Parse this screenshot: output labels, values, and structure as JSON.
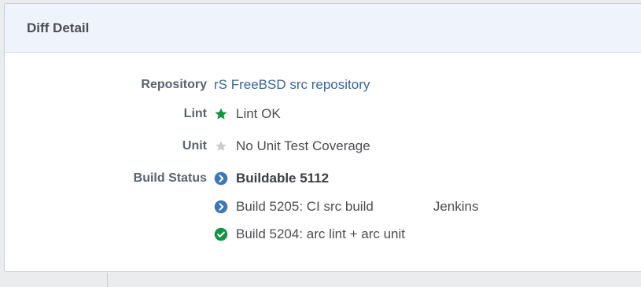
{
  "panel": {
    "title": "Diff Detail"
  },
  "details": {
    "repository": {
      "label": "Repository",
      "value": "rS FreeBSD src repository"
    },
    "lint": {
      "label": "Lint",
      "icon": "star-icon",
      "icon_color": "#139543",
      "value": "Lint OK"
    },
    "unit": {
      "label": "Unit",
      "icon": "star-icon",
      "icon_color": "#c8cbd0",
      "value": "No Unit Test Coverage"
    },
    "build_status": {
      "label": "Build Status",
      "buildable": {
        "icon": "chevron-circle-right-icon",
        "icon_color": "#3c77b8",
        "text": "Buildable 5112"
      },
      "builds": [
        {
          "icon": "chevron-circle-right-icon",
          "icon_color": "#3c77b8",
          "text": "Build 5205: CI src build",
          "runner": "Jenkins"
        },
        {
          "icon": "check-circle-icon",
          "icon_color": "#139543",
          "text": "Build 5204: arc lint + arc unit",
          "runner": ""
        }
      ]
    }
  }
}
